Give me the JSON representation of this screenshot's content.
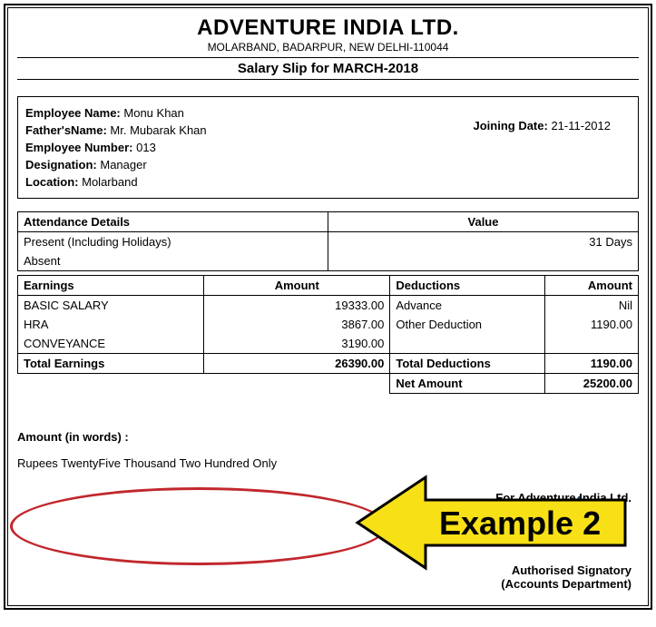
{
  "company": {
    "name": "ADVENTURE INDIA LTD.",
    "address": "MOLARBAND, BADARPUR, NEW DELHI-110044"
  },
  "title": "Salary Slip for MARCH-2018",
  "employee": {
    "name_label": "Employee Name:",
    "name": "Monu Khan",
    "father_label": "Father'sName:",
    "father": "Mr. Mubarak Khan",
    "number_label": "Employee Number:",
    "number": "013",
    "designation_label": "Designation:",
    "designation": "Manager",
    "location_label": "Location:",
    "location": "Molarband",
    "joining_label": "Joining Date:",
    "joining": "21-11-2012"
  },
  "attendance": {
    "header": "Attendance Details",
    "value_header": "Value",
    "present_label": "Present (Including Holidays)",
    "present_value": "31 Days",
    "absent_label": "Absent",
    "absent_value": ""
  },
  "earnings": {
    "header": "Earnings",
    "amount_header": "Amount",
    "rows": [
      {
        "label": "BASIC SALARY",
        "amount": "19333.00"
      },
      {
        "label": "HRA",
        "amount": "3867.00"
      },
      {
        "label": "CONVEYANCE",
        "amount": "3190.00"
      }
    ],
    "total_label": "Total Earnings",
    "total": "26390.00"
  },
  "deductions": {
    "header": "Deductions",
    "amount_header": "Amount",
    "rows": [
      {
        "label": "Advance",
        "amount": "Nil"
      },
      {
        "label": "Other Deduction",
        "amount": "1190.00"
      },
      {
        "label": "",
        "amount": ""
      }
    ],
    "total_label": "Total Deductions",
    "total": "1190.00",
    "net_label": "Net Amount",
    "net": "25200.00"
  },
  "words": {
    "label": "Amount (in words) :",
    "value": "Rupees TwentyFive Thousand Two Hundred  Only"
  },
  "for_line": "For Adventure India Ltd.",
  "signatory": {
    "line1": "Authorised Signatory",
    "line2": "(Accounts Department)"
  },
  "annotation": "Example 2"
}
